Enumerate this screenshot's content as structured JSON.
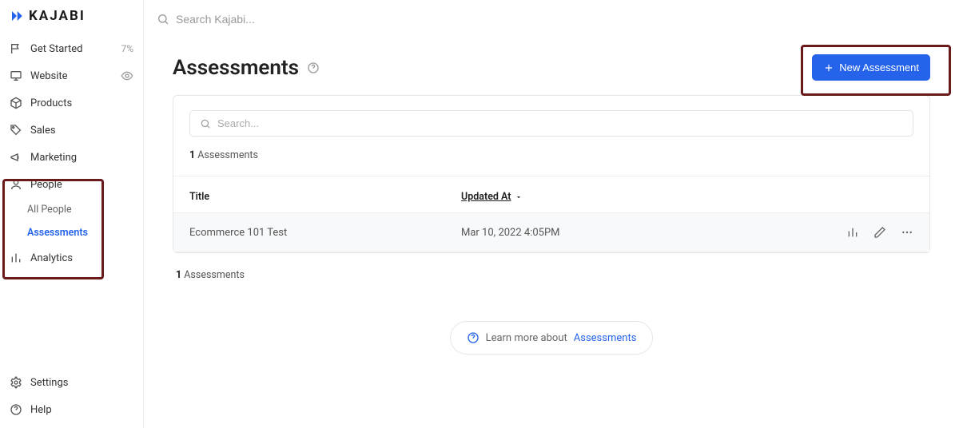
{
  "brand": "KAJABI",
  "topbar": {
    "search_placeholder": "Search Kajabi..."
  },
  "sidebar": {
    "items": [
      {
        "icon": "flag-icon",
        "label": "Get Started",
        "trail": "7%"
      },
      {
        "icon": "monitor-icon",
        "label": "Website",
        "trail_icon": "eye-icon"
      },
      {
        "icon": "cube-icon",
        "label": "Products"
      },
      {
        "icon": "tag-icon",
        "label": "Sales"
      },
      {
        "icon": "megaphone-icon",
        "label": "Marketing"
      },
      {
        "icon": "user-icon",
        "label": "People",
        "sub": [
          {
            "label": "All People"
          },
          {
            "label": "Assessments",
            "active": true
          }
        ]
      },
      {
        "icon": "bars-icon",
        "label": "Analytics"
      }
    ],
    "bottom": [
      {
        "icon": "gear-icon",
        "label": "Settings"
      },
      {
        "icon": "help-icon",
        "label": "Help"
      }
    ]
  },
  "page": {
    "title": "Assessments",
    "new_button": "New Assessment",
    "search_placeholder": "Search...",
    "count_num": "1",
    "count_label": "Assessments",
    "columns": {
      "title": "Title",
      "updated": "Updated At"
    },
    "rows": [
      {
        "title": "Ecommerce 101 Test",
        "updated": "Mar 10, 2022 4:05PM"
      }
    ],
    "footer_count_num": "1",
    "footer_count_label": "Assessments",
    "learn_prefix": "Learn more about ",
    "learn_link": "Assessments"
  }
}
